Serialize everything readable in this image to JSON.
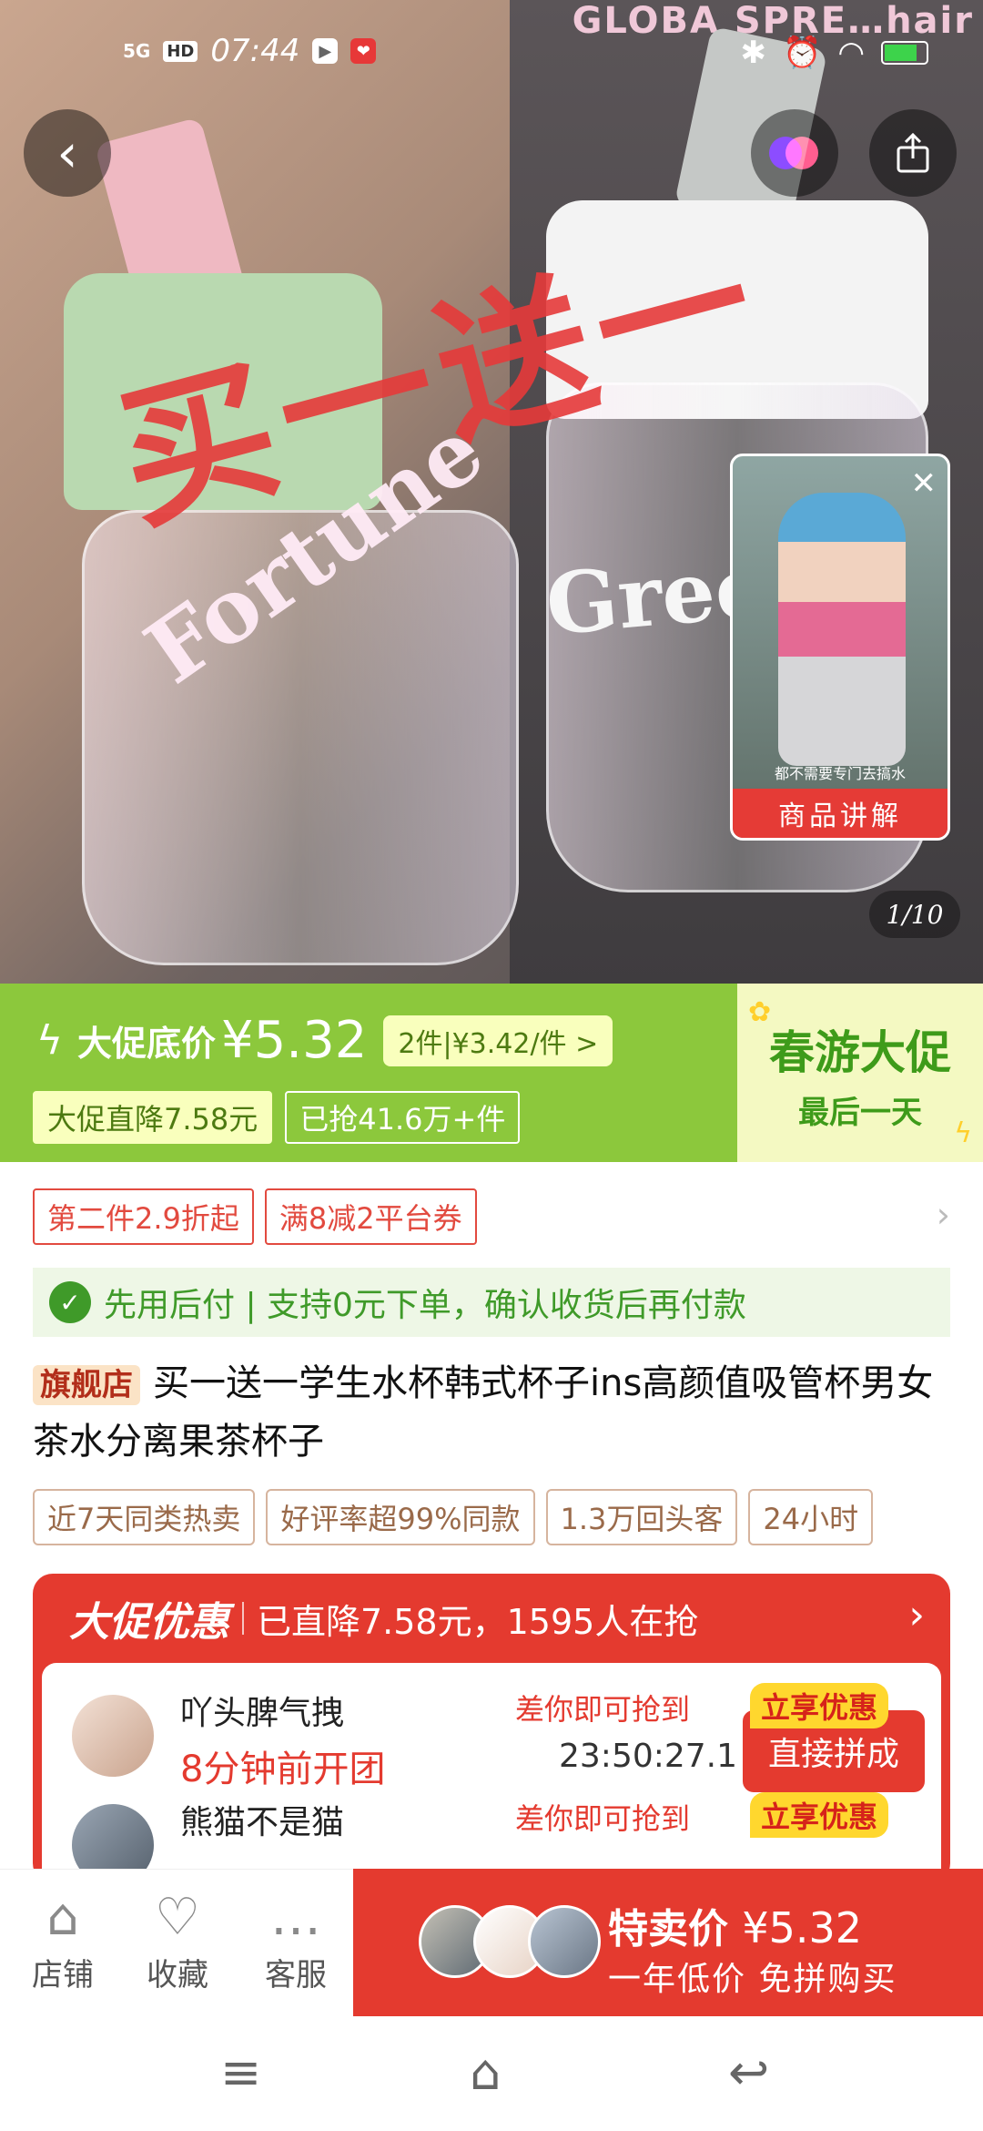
{
  "status_bar": {
    "signal": "5G",
    "hd": "HD",
    "time": "07:44",
    "battery_level": 0.8
  },
  "hero": {
    "shirt_text": "GLOBA SPRE…hair",
    "overlay_text": "买一送一",
    "cup_left_text": "Fortune",
    "cup_right_text": "Gree",
    "video": {
      "caption": "商品讲解",
      "subtitle": "都不需要专门去搞水"
    },
    "page_indicator": "1/10"
  },
  "promo": {
    "low_label": "大促底价",
    "price": "¥5.32",
    "multi": "2件|¥3.42/件 >",
    "drop_tag": "大促直降7.58元",
    "sold_tag": "已抢41.6万+件",
    "spring_title": "春游大促",
    "spring_sub": "最后一天"
  },
  "coupons": [
    "第二件2.9折起",
    "满8减2平台券"
  ],
  "payline": "先用后付 | 支持0元下单，确认收货后再付款",
  "product": {
    "flag": "旗舰店",
    "title": "买一送一学生水杯韩式杯子ins高颜值吸管杯男女茶水分离果茶杯子"
  },
  "tags": [
    "近7天同类热卖",
    "好评率超99%同款",
    "1.3万回头客",
    "24小时"
  ],
  "deal": {
    "label": "大促优惠",
    "text": "已直降7.58元，1595人在抢",
    "rows": [
      {
        "name": "吖头脾气拽",
        "when": "8分钟前开团",
        "need": "差你即可抢到",
        "time": "23:50:27.1",
        "enjoy": "立享优惠",
        "btn": "直接拼成"
      },
      {
        "name": "熊猫不是猫",
        "when": "",
        "need": "差你即可抢到",
        "time": "",
        "enjoy": "立享优惠",
        "btn": ""
      }
    ]
  },
  "bottom": {
    "shop": "店铺",
    "fav": "收藏",
    "cs": "客服",
    "buy_title": "特卖价",
    "buy_price": "¥5.32",
    "buy_sub": "一年低价 免拼购买"
  },
  "nav": {
    "menu": "≡",
    "home": "⌂",
    "back": "↩"
  }
}
